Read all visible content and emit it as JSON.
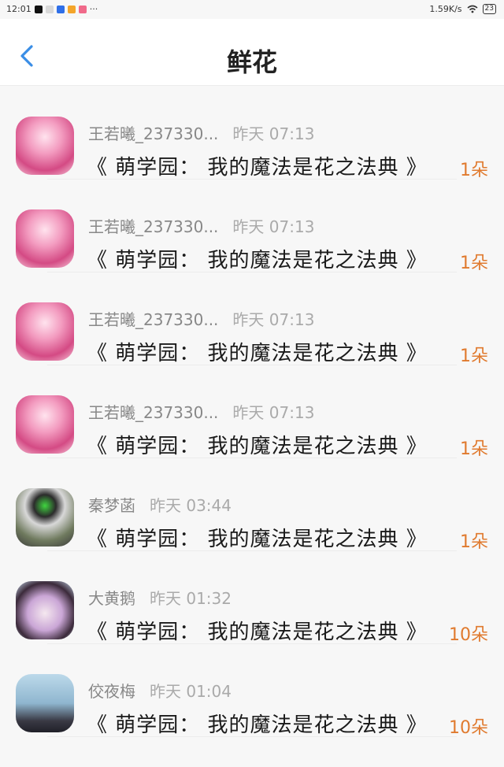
{
  "status": {
    "time": "12:01",
    "dots": "···",
    "speed": "1.59K/s",
    "battery": "23"
  },
  "header": {
    "title": "鲜花"
  },
  "items": [
    {
      "user": "王若曦_237330...",
      "time": "昨天 07:13",
      "book": "《 萌学园： 我的魔法是花之法典 》",
      "count": "1朵"
    },
    {
      "user": "王若曦_237330...",
      "time": "昨天 07:13",
      "book": "《 萌学园： 我的魔法是花之法典 》",
      "count": "1朵"
    },
    {
      "user": "王若曦_237330...",
      "time": "昨天 07:13",
      "book": "《 萌学园： 我的魔法是花之法典 》",
      "count": "1朵"
    },
    {
      "user": "王若曦_237330...",
      "time": "昨天 07:13",
      "book": "《 萌学园： 我的魔法是花之法典 》",
      "count": "1朵"
    },
    {
      "user": "秦梦菡",
      "time": "昨天 03:44",
      "book": "《 萌学园： 我的魔法是花之法典 》",
      "count": "1朵"
    },
    {
      "user": "大黄鹅",
      "time": "昨天 01:32",
      "book": "《 萌学园： 我的魔法是花之法典 》",
      "count": "10朵"
    },
    {
      "user": "佼夜梅",
      "time": "昨天 01:04",
      "book": "《 萌学园： 我的魔法是花之法典 》",
      "count": "10朵"
    }
  ]
}
